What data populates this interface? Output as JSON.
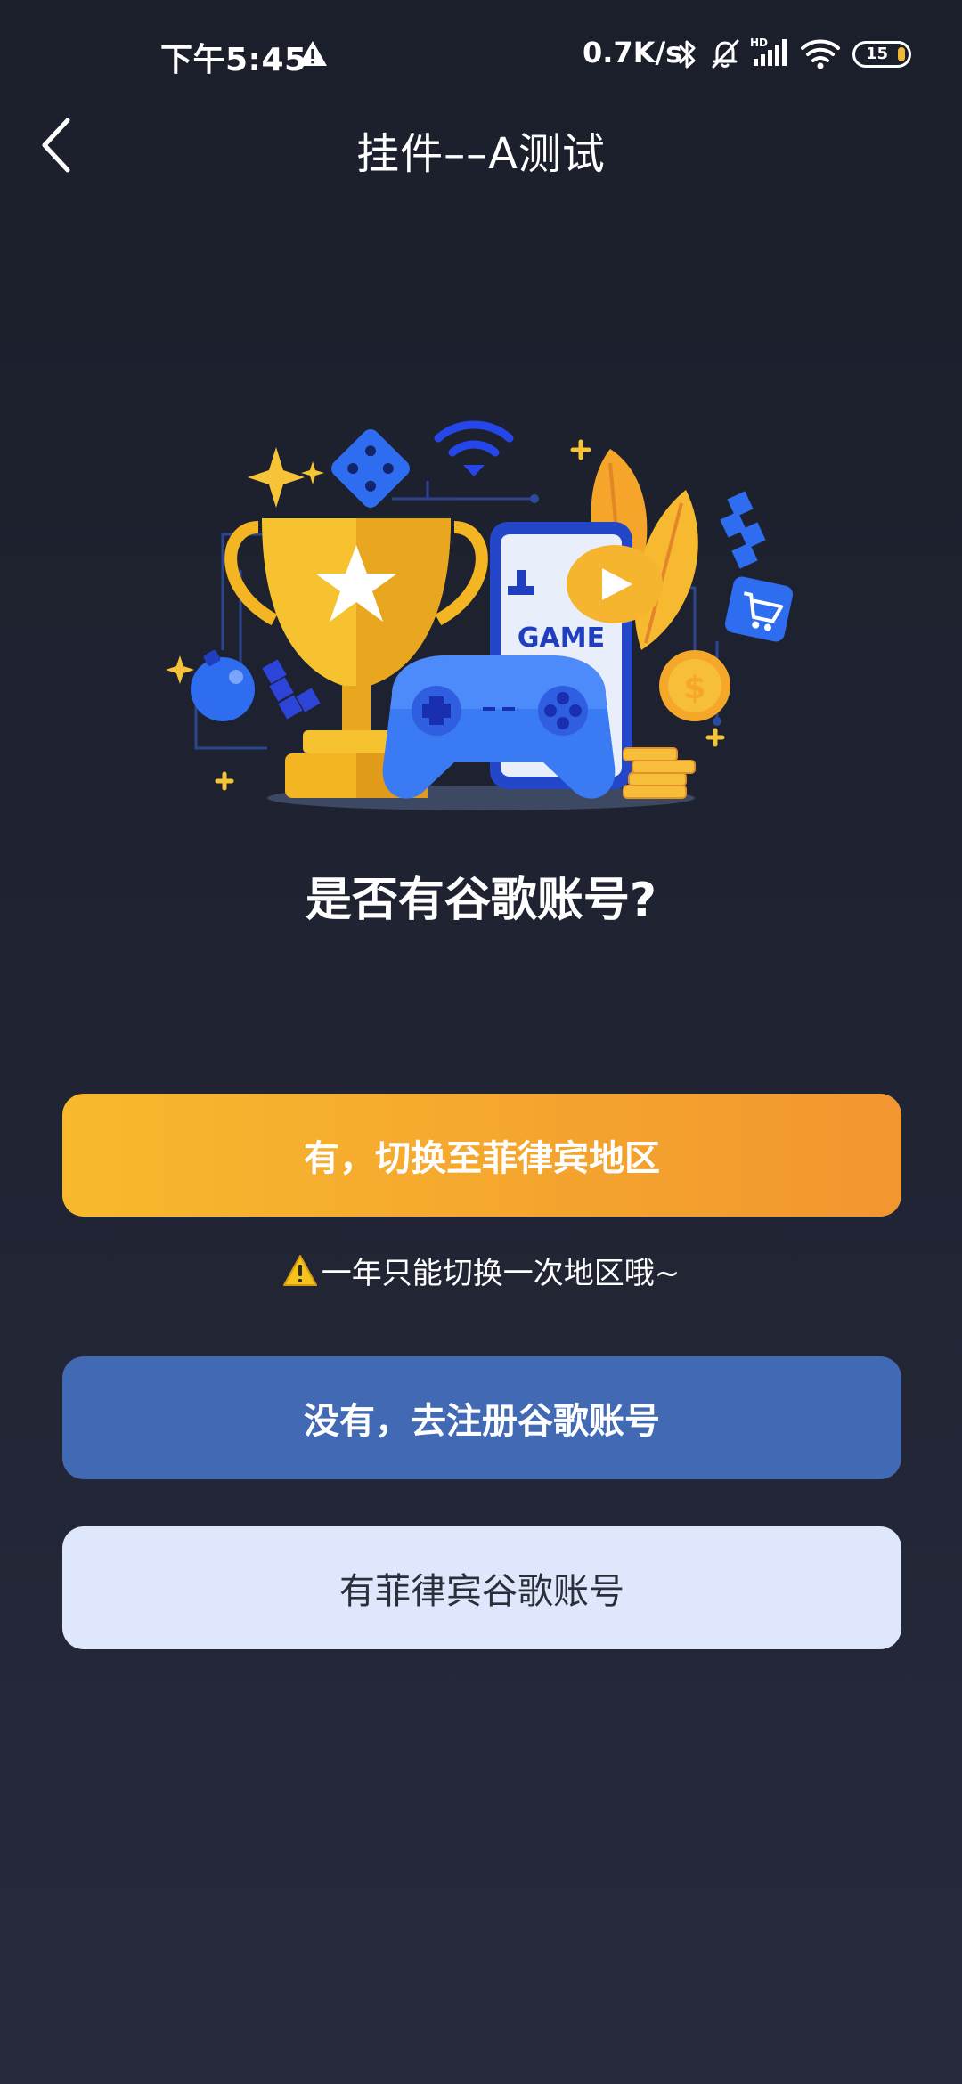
{
  "status_bar": {
    "time": "下午5:45",
    "network_speed": "0.7K/s",
    "signal_label": "HD",
    "battery_level": "15",
    "icons": [
      "warning-icon",
      "bluetooth-icon",
      "mute-icon",
      "signal-icon",
      "wifi-icon",
      "battery-icon"
    ]
  },
  "nav": {
    "title": "挂件––A测试",
    "back_icon": "chevron-left-icon"
  },
  "hero": {
    "phone_text": "GAME",
    "illustration": "game-trophy-illustration"
  },
  "main": {
    "question": "是否有谷歌账号?",
    "switch_button": "有，切换至菲律宾地区",
    "notice": "一年只能切换一次地区哦~",
    "register_button": "没有，去注册谷歌账号",
    "has_account_button": "有菲律宾谷歌账号"
  },
  "colors": {
    "background": "#1b1f2b",
    "accent_orange_start": "#f8b92d",
    "accent_orange_end": "#f2962f",
    "accent_blue": "#4169b4",
    "light_button": "#dee7fb"
  }
}
